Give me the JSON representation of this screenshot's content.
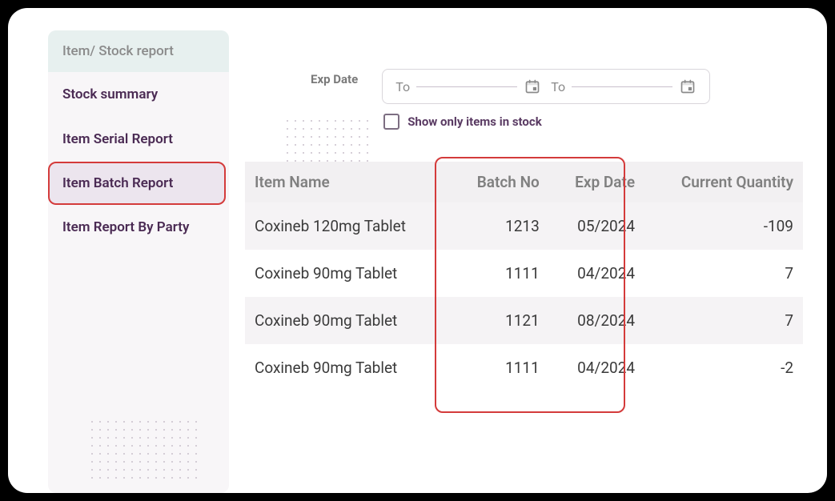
{
  "sidebar": {
    "header": "Item/ Stock report",
    "items": [
      {
        "label": "Stock summary",
        "selected": false
      },
      {
        "label": "Item Serial Report",
        "selected": false
      },
      {
        "label": "Item Batch Report",
        "selected": true
      },
      {
        "label": "Item Report By Party",
        "selected": false
      }
    ]
  },
  "filters": {
    "exp_date_label": "Exp Date",
    "date_from_label": "To",
    "date_to_label": "To",
    "show_in_stock_label": "Show only items in stock",
    "show_in_stock_checked": false
  },
  "table": {
    "headers": {
      "item_name": "Item Name",
      "batch_no": "Batch No",
      "exp_date": "Exp Date",
      "current_qty": "Current Quantity"
    },
    "rows": [
      {
        "item_name": "Coxineb 120mg Tablet",
        "batch_no": "1213",
        "exp_date": "05/2024",
        "current_qty": "-109"
      },
      {
        "item_name": "Coxineb 90mg Tablet",
        "batch_no": "1111",
        "exp_date": "04/2024",
        "current_qty": "7"
      },
      {
        "item_name": "Coxineb 90mg Tablet",
        "batch_no": "1121",
        "exp_date": "08/2024",
        "current_qty": "7"
      },
      {
        "item_name": "Coxineb 90mg Tablet",
        "batch_no": "1111",
        "exp_date": "04/2024",
        "current_qty": "-2"
      }
    ]
  }
}
